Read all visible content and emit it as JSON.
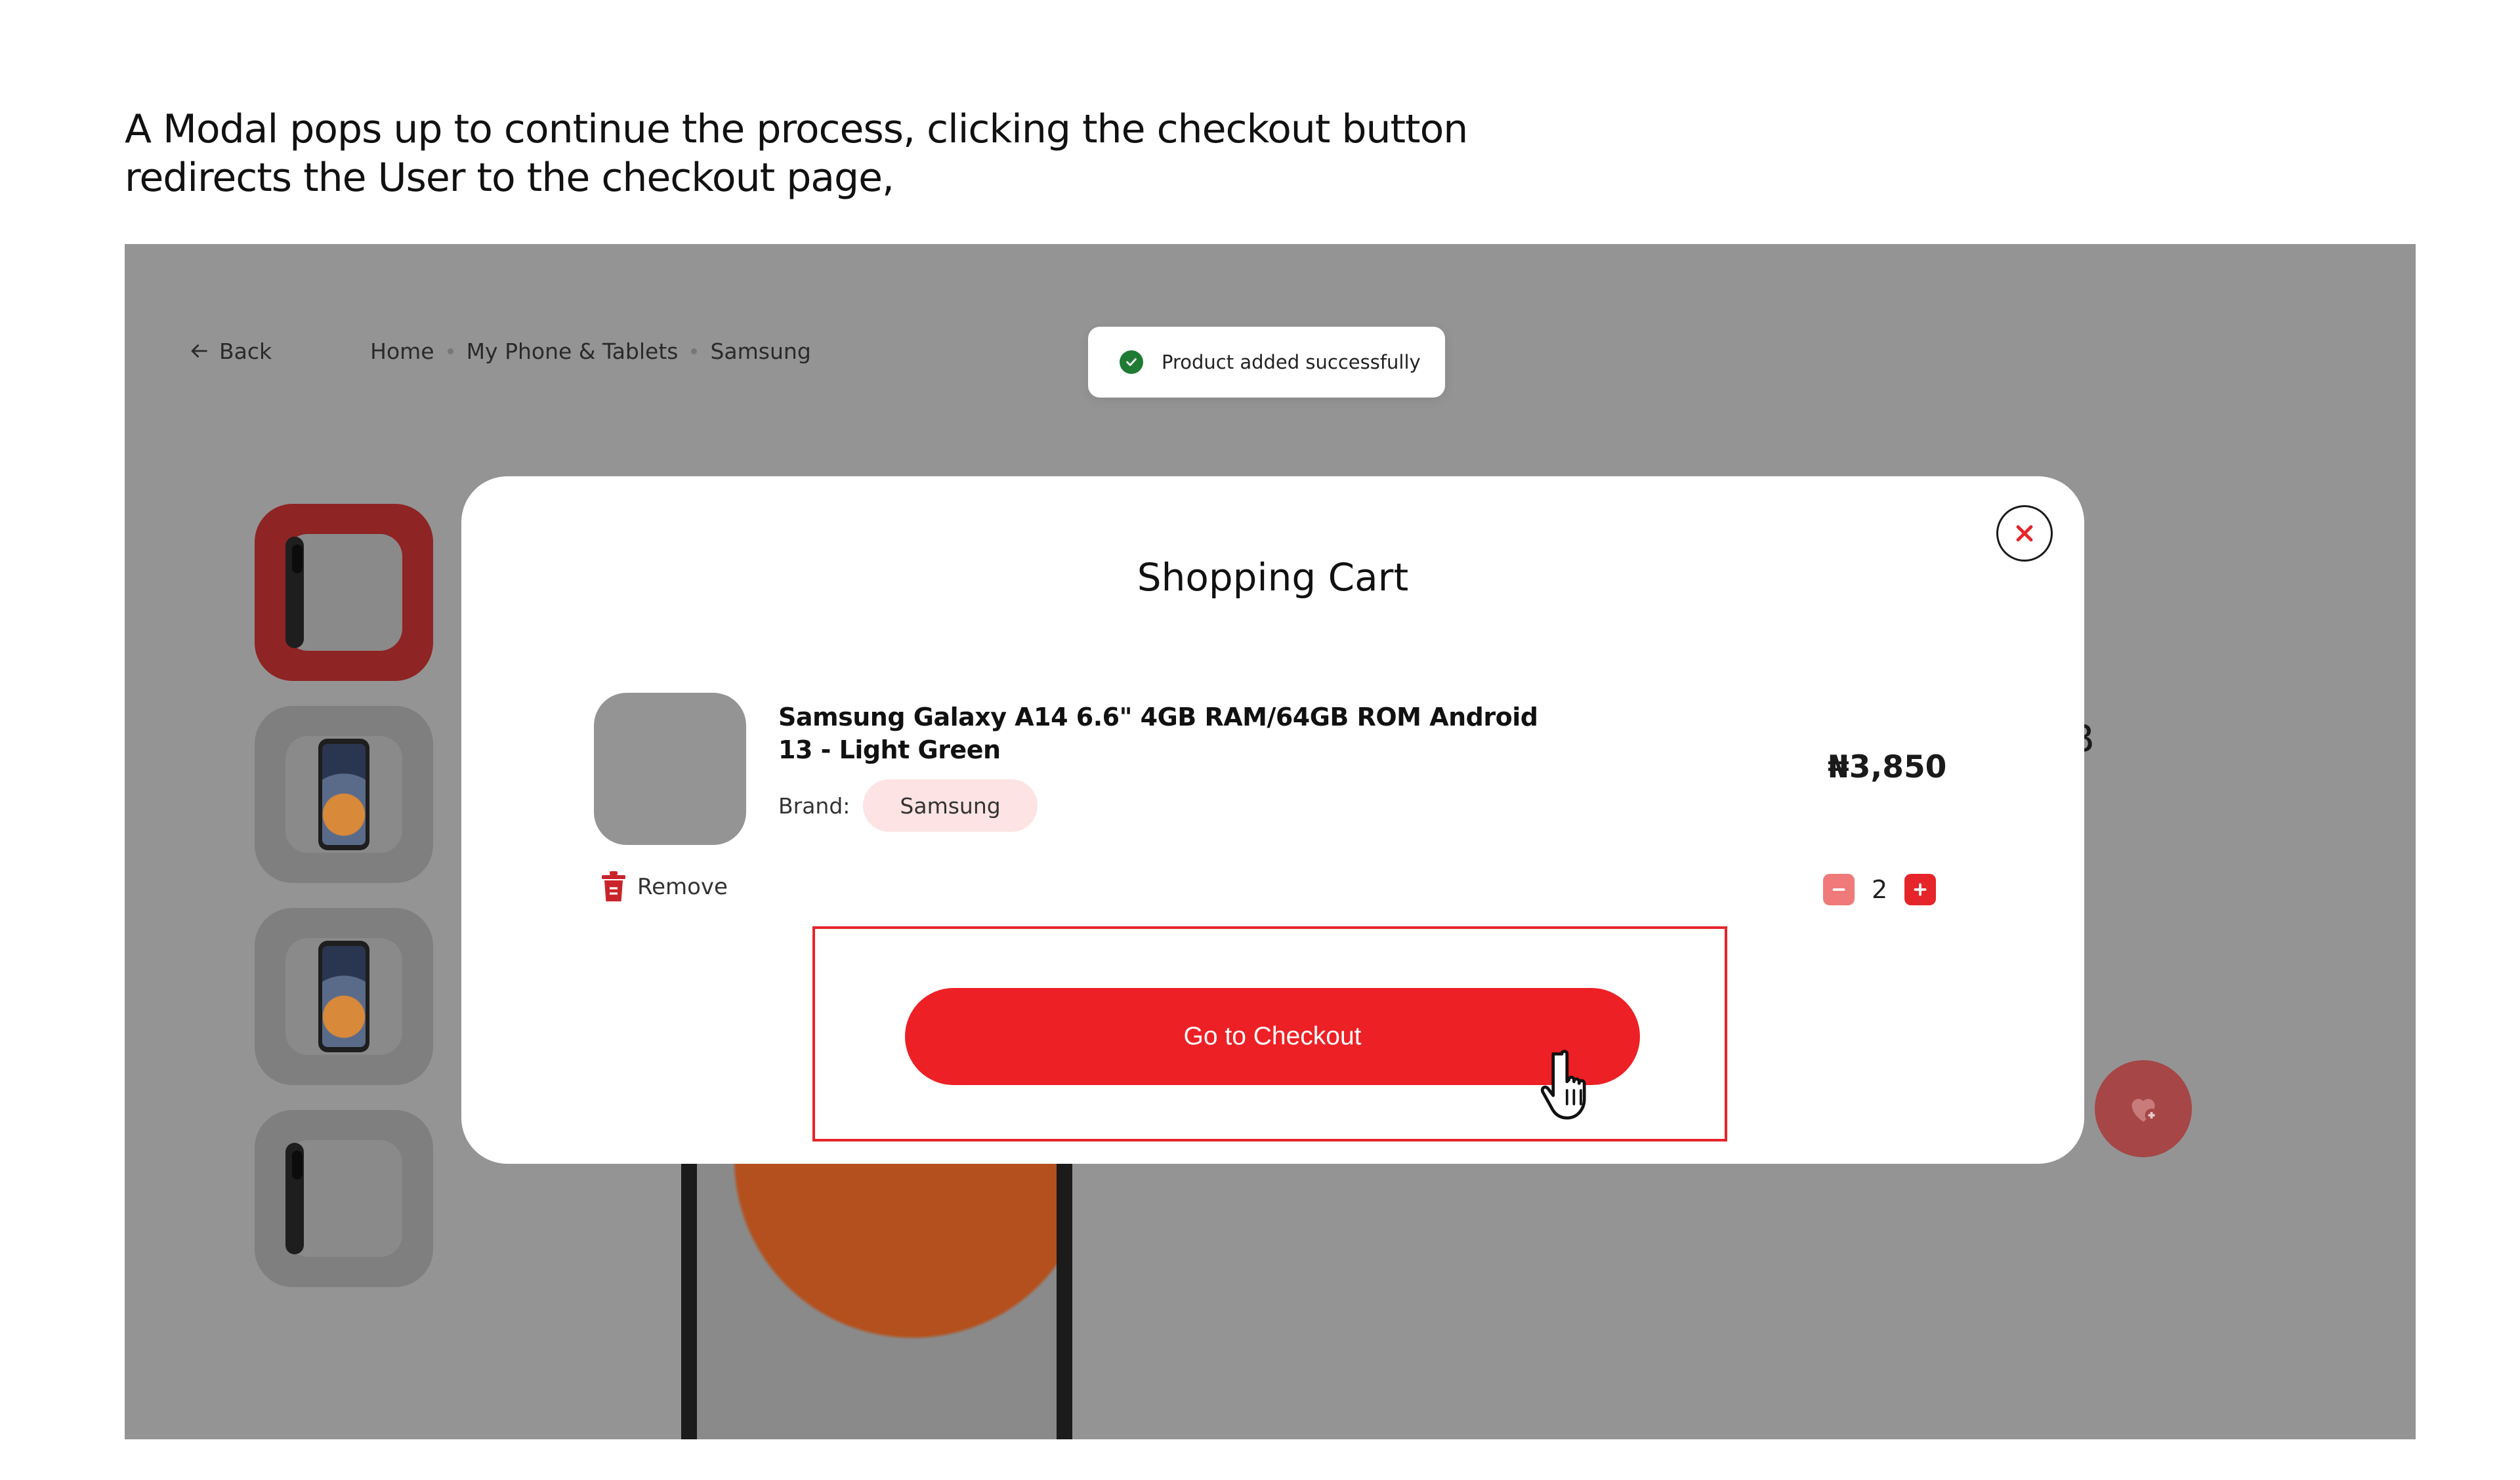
{
  "annotation": {
    "line1": "A Modal pops up to continue the process, clicking the checkout button",
    "line2": "redirects the User to the checkout page,"
  },
  "page": {
    "back_label": "Back",
    "breadcrumb": [
      "Home",
      "My Phone & Tablets",
      "Samsung"
    ],
    "toast": "Product added successfully",
    "peek_text": "B"
  },
  "modal": {
    "title": "Shopping Cart",
    "item": {
      "name": "Samsung Galaxy A14 6.6\" 4GB RAM/64GB ROM Android 13 - Light Green",
      "brand_label": "Brand:",
      "brand": "Samsung",
      "price": "₦3,850",
      "remove_label": "Remove",
      "quantity": "2"
    },
    "checkout_label": "Go to Checkout"
  },
  "colors": {
    "accent": "#ed2025",
    "overlay": "#949494",
    "brand_pill": "#fde3e3",
    "toast_check": "#1f7a33"
  },
  "icons": [
    "back-arrow-icon",
    "check-circle-icon",
    "close-icon",
    "trash-icon",
    "minus-icon",
    "plus-icon",
    "heart-plus-icon",
    "hand-cursor-icon"
  ]
}
